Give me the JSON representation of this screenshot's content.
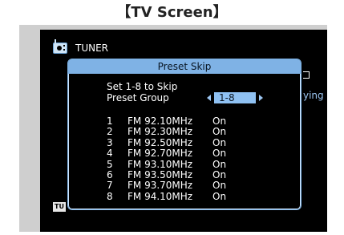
{
  "page_title": "【TV Screen】",
  "source": {
    "icon": "tuner-radio-icon",
    "label": "TUNER"
  },
  "dialog": {
    "title": "Preset Skip",
    "line1": "Set 1-8 to Skip",
    "preset_group_label": "Preset Group",
    "preset_group_value": "1-8",
    "presets": [
      {
        "num": "1",
        "freq": "FM 92.10MHz",
        "status": "On"
      },
      {
        "num": "2",
        "freq": "FM 92.30MHz",
        "status": "On"
      },
      {
        "num": "3",
        "freq": "FM 92.50MHz",
        "status": "On"
      },
      {
        "num": "4",
        "freq": "FM 92.70MHz",
        "status": "On"
      },
      {
        "num": "5",
        "freq": "FM 93.10MHz",
        "status": "On"
      },
      {
        "num": "6",
        "freq": "FM 93.50MHz",
        "status": "On"
      },
      {
        "num": "7",
        "freq": "FM 93.70MHz",
        "status": "On"
      },
      {
        "num": "8",
        "freq": "FM 94.10MHz",
        "status": "On"
      }
    ]
  },
  "background": {
    "partial_text": "ying",
    "badge": "TU"
  },
  "colors": {
    "dialog_header": "#7fb2e5",
    "selection": "#8fc1f2",
    "screen_bg": "#000000",
    "frame_bg": "#cfcfcf"
  }
}
